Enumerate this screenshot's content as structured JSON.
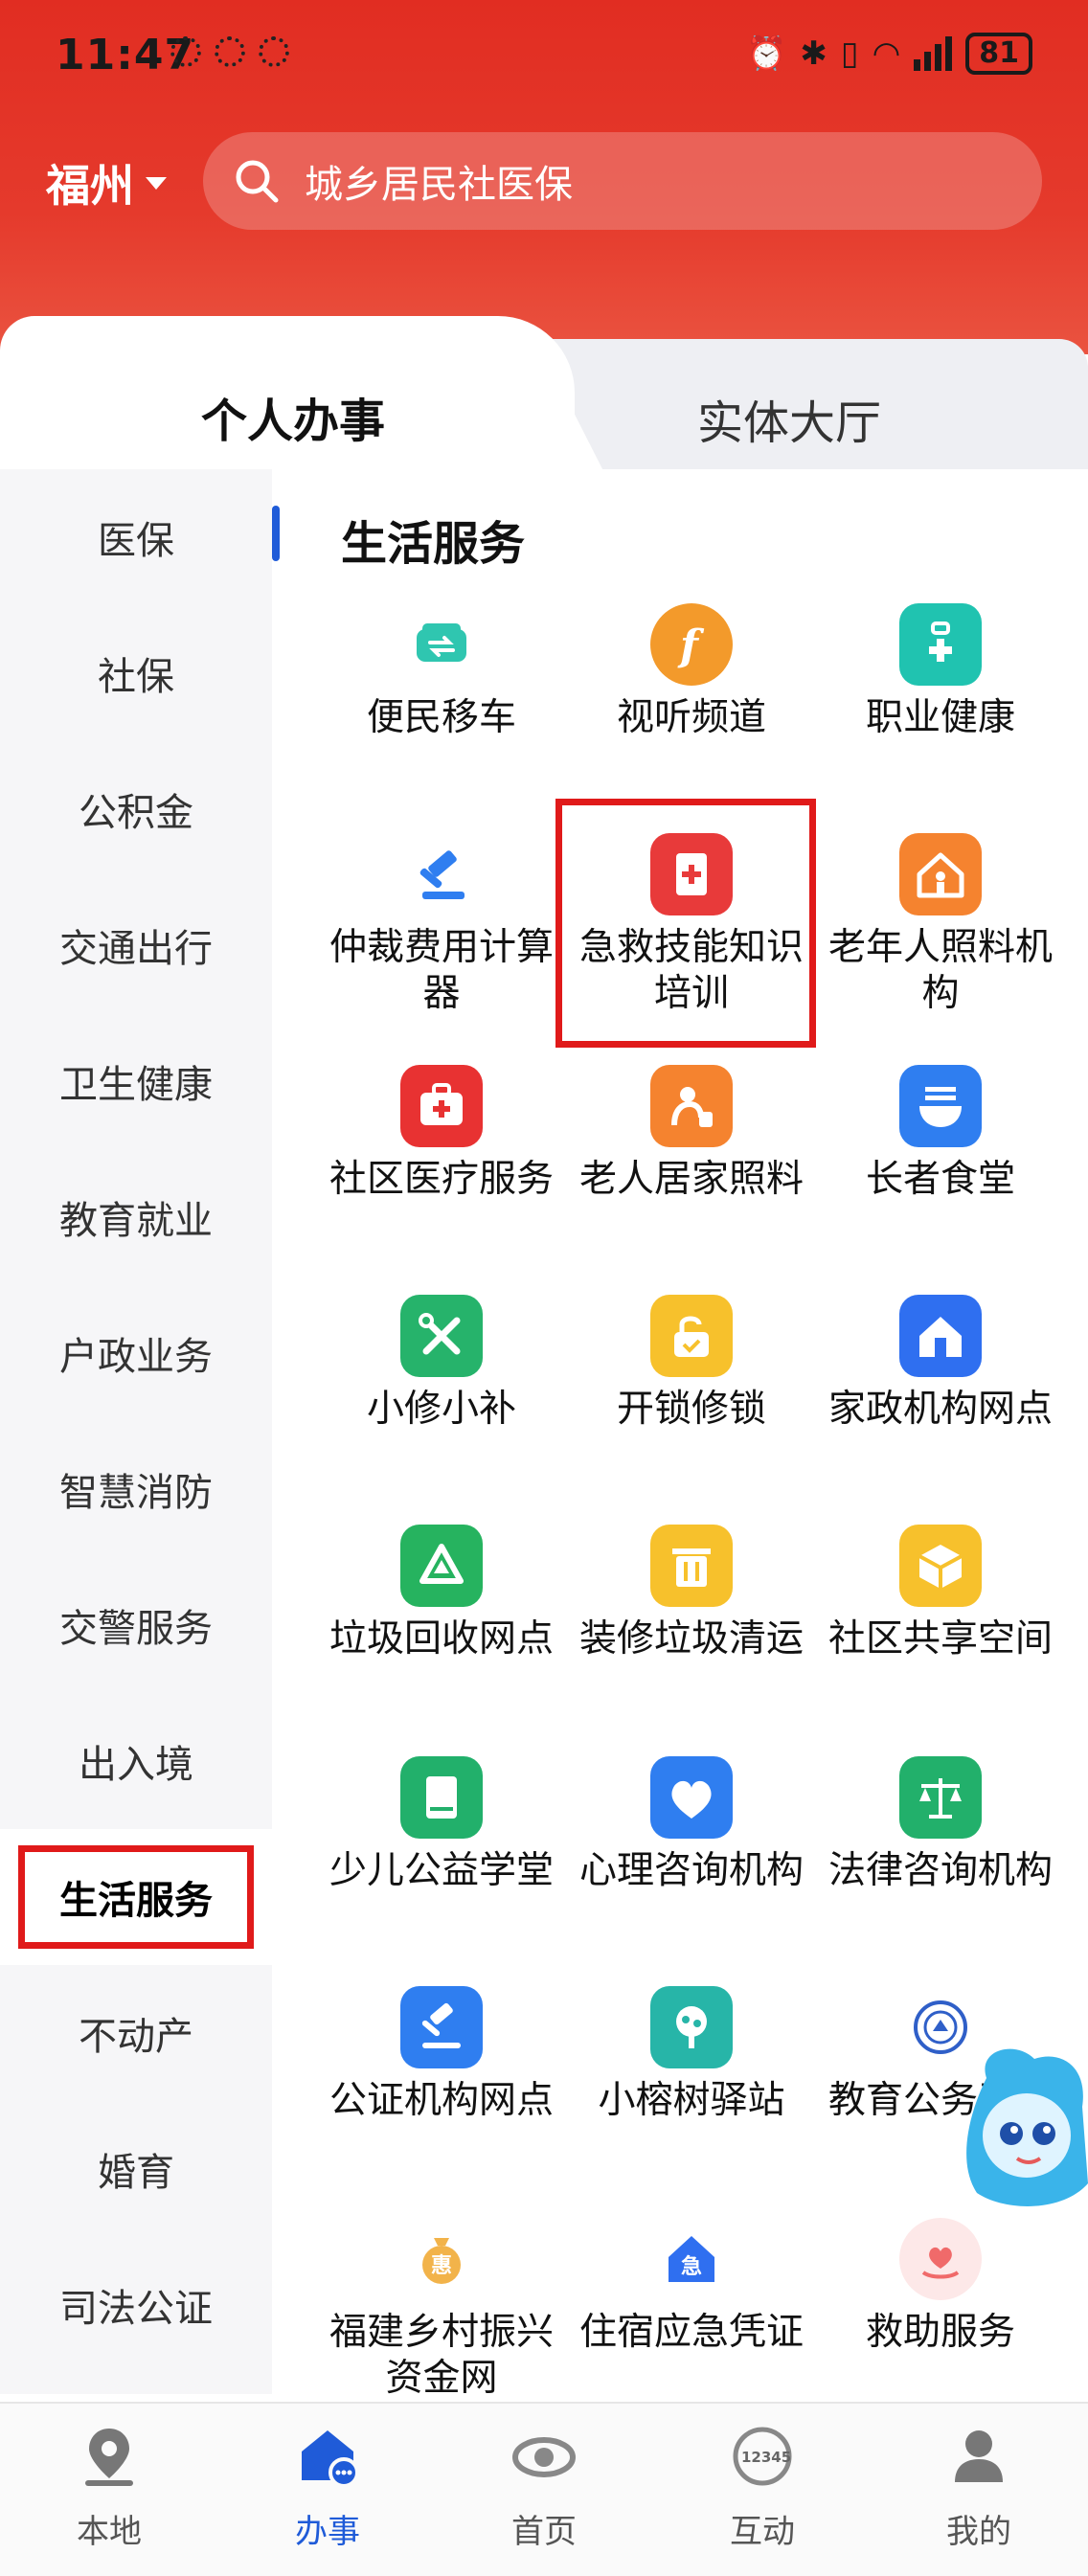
{
  "status": {
    "time": "11:47",
    "battery": "81"
  },
  "header": {
    "city": "福州",
    "search_placeholder": "城乡居民社医保"
  },
  "tabs": {
    "active": "个人办事",
    "inactive": "实体大厅"
  },
  "sidebar": {
    "items": [
      "医保",
      "社保",
      "公积金",
      "交通出行",
      "卫生健康",
      "教育就业",
      "户政业务",
      "智慧消防",
      "交警服务",
      "出入境",
      "生活服务",
      "不动产",
      "婚育",
      "司法公证"
    ],
    "active_index": 10
  },
  "section": {
    "title": "生活服务"
  },
  "services": [
    {
      "label": "便民移车",
      "icon": "car-swap-icon",
      "color": "#2fc6b0"
    },
    {
      "label": "视听频道",
      "icon": "media-f-icon",
      "color": "#f39a2b"
    },
    {
      "label": "职业健康",
      "icon": "medkit-icon",
      "color": "#20c3b0"
    },
    {
      "label": "仲裁费用计算器",
      "icon": "gavel-icon",
      "color": "#2f7ef0"
    },
    {
      "label": "急救技能知识培训",
      "icon": "first-aid-card-icon",
      "color": "#e83a3a"
    },
    {
      "label": "老年人照料机构",
      "icon": "elderly-home-icon",
      "color": "#f5832f"
    },
    {
      "label": "社区医疗服务",
      "icon": "medical-box-icon",
      "color": "#e83232"
    },
    {
      "label": "老人居家照料",
      "icon": "elderly-care-icon",
      "color": "#f5832f"
    },
    {
      "label": "长者食堂",
      "icon": "canteen-bowl-icon",
      "color": "#2f7ef0"
    },
    {
      "label": "小修小补",
      "icon": "tools-icon",
      "color": "#26b36b"
    },
    {
      "label": "开锁修锁",
      "icon": "unlock-icon",
      "color": "#f7c12c"
    },
    {
      "label": "家政机构网点",
      "icon": "house-clean-icon",
      "color": "#2f6ff0"
    },
    {
      "label": "垃圾回收网点",
      "icon": "recycle-icon",
      "color": "#26b35f"
    },
    {
      "label": "装修垃圾清运",
      "icon": "trash-bin-icon",
      "color": "#f7c12c"
    },
    {
      "label": "社区共享空间",
      "icon": "share-box-icon",
      "color": "#f7c12c"
    },
    {
      "label": "少儿公益学堂",
      "icon": "book-icon",
      "color": "#22b06b"
    },
    {
      "label": "心理咨询机构",
      "icon": "heart-phone-icon",
      "color": "#2f7ef0"
    },
    {
      "label": "法律咨询机构",
      "icon": "scales-icon",
      "color": "#22b06b"
    },
    {
      "label": "公证机构网点",
      "icon": "notary-gavel-icon",
      "color": "#2f7ef0"
    },
    {
      "label": "小榕树驿站",
      "icon": "banyan-tree-icon",
      "color": "#27b5a8"
    },
    {
      "label": "教育公务平台",
      "icon": "education-seal-icon",
      "color": "#2f5fc8"
    },
    {
      "label": "福建乡村振兴资金网",
      "icon": "money-bag-icon",
      "color": "#f2b34a"
    },
    {
      "label": "住宿应急凭证",
      "icon": "emergency-house-icon",
      "color": "#2f6ff0"
    },
    {
      "label": "救助服务",
      "icon": "helping-heart-icon",
      "color": "#f08a8a"
    }
  ],
  "bottom_nav": [
    {
      "label": "本地",
      "icon": "location-pin-icon"
    },
    {
      "label": "办事",
      "icon": "service-hall-icon",
      "active": true
    },
    {
      "label": "首页",
      "icon": "logo-eye-icon"
    },
    {
      "label": "互动",
      "icon": "hotline-12345-icon",
      "badge": "12345"
    },
    {
      "label": "我的",
      "icon": "user-icon"
    }
  ]
}
